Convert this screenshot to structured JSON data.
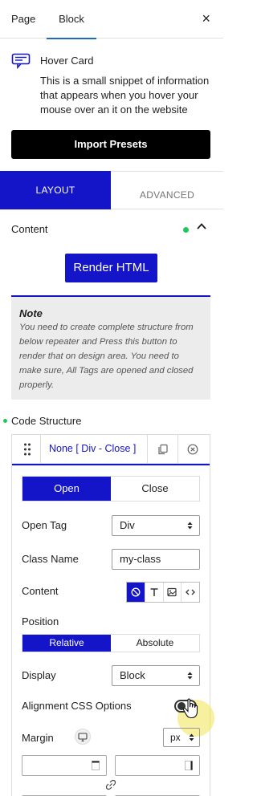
{
  "top_tabs": {
    "page": "Page",
    "block": "Block",
    "close": "×"
  },
  "block_card": {
    "title": "Hover Card",
    "description": "This is a small snippet of information that appears when you hover your mouse over an it on the website",
    "import_button": "Import Presets"
  },
  "panel_tabs": {
    "layout": "LAYOUT",
    "advanced": "ADVANCED"
  },
  "content_section": {
    "heading": "Content",
    "render_button": "Render HTML",
    "note_title": "Note",
    "note_text": "You need to create complete structure from below repeater and Press this button to render that on design area. You need to make sure, All Tags are opened and closed properly."
  },
  "code_structure": {
    "heading": "Code Structure",
    "repeater_item_title": "None [ Div - Close ]",
    "tag_mode": {
      "open": "Open",
      "close": "Close",
      "selected": "Open"
    },
    "open_tag": {
      "label": "Open Tag",
      "value": "Div"
    },
    "class_name": {
      "label": "Class Name",
      "value": "my-class"
    },
    "content": {
      "label": "Content",
      "options": [
        "none-icon",
        "text-icon",
        "image-icon",
        "code-icon"
      ],
      "selected": "none-icon"
    },
    "position": {
      "label": "Position",
      "relative": "Relative",
      "absolute": "Absolute",
      "selected": "Relative"
    },
    "display": {
      "label": "Display",
      "value": "Block"
    },
    "alignment": {
      "label": "Alignment CSS Options",
      "enabled": false
    },
    "margin": {
      "label": "Margin",
      "unit": "px",
      "top": "",
      "right": "",
      "bottom": "",
      "left": ""
    }
  },
  "colors": {
    "accent": "#1414c8",
    "status_green": "#22c55e",
    "dark_button": "#000000"
  }
}
